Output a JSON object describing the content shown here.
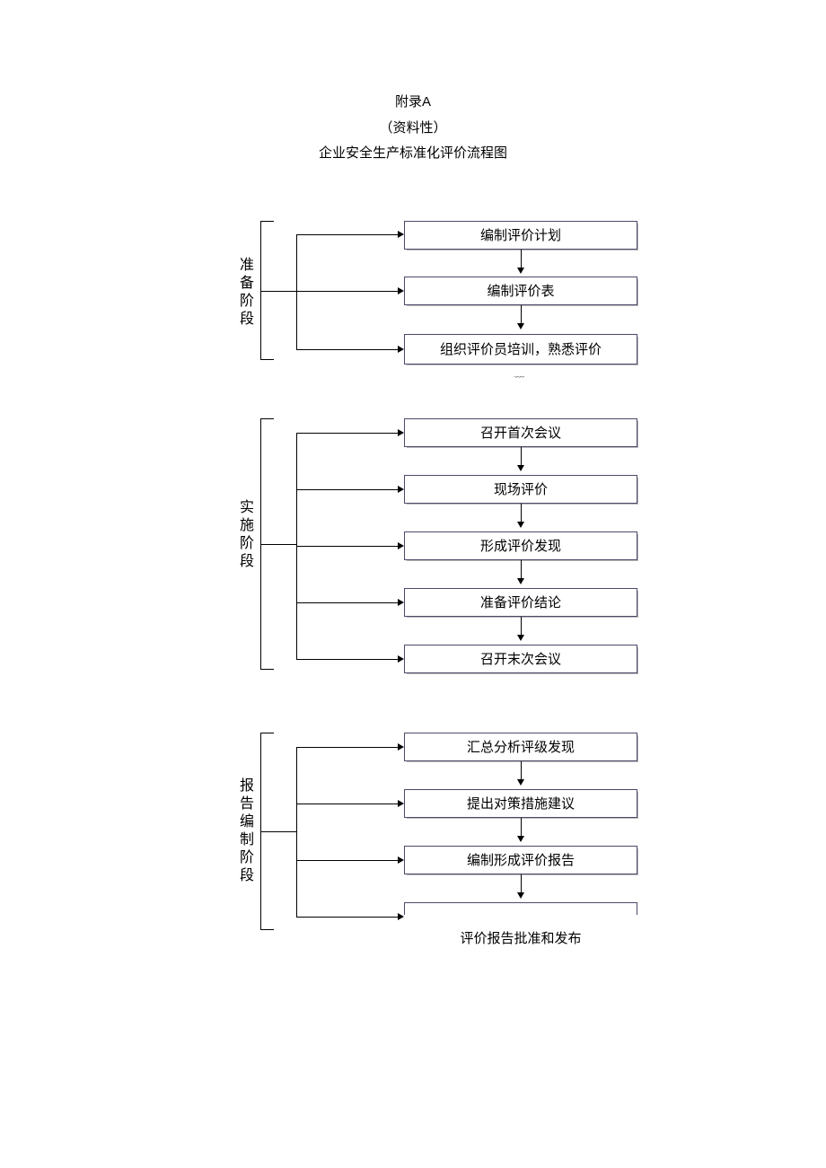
{
  "header": {
    "line1": "附录A",
    "line2": "（资料性）",
    "line3": "企业安全生产标准化评价流程图"
  },
  "stages": [
    {
      "label": "准备阶段",
      "steps": [
        "编制评价计划",
        "编制评价表",
        "组织评价员培训，熟悉评价"
      ]
    },
    {
      "label": "实施阶段",
      "steps": [
        "召开首次会议",
        "现场评价",
        "形成评价发现",
        "准备评价结论",
        "召开末次会议"
      ]
    },
    {
      "label": "报告编制阶段",
      "steps": [
        "汇总分析评级发现",
        "提出对策措施建议",
        "编制形成评价报告",
        "评价报告批准和发布"
      ]
    }
  ]
}
